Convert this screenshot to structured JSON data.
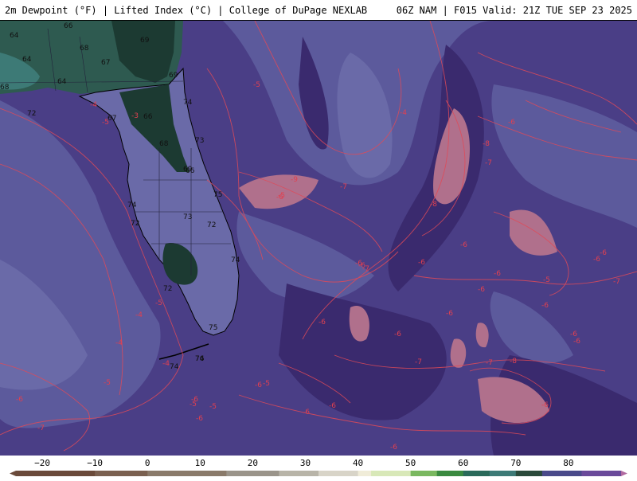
{
  "header": {
    "left_text": "2m Dewpoint (°F) | Lifted Index (°C) | College of DuPage NEXLAB",
    "right_text": "06Z NAM | F015 Valid: 21Z TUE SEP 23 2025"
  },
  "map": {
    "colors": {
      "ocean_deep": "#3a2a6e",
      "ocean_mid": "#4a3e86",
      "ocean_light": "#5c5a9c",
      "land_dew": "#6a6aa8",
      "green_dark": "#1c3a32",
      "green_mid": "#2e5a50",
      "teal": "#3d7a76",
      "pink": "#b0708c",
      "contour": "#e04a58"
    },
    "lifted_index_labels": [
      "-4",
      "-5",
      "-3",
      "-4",
      "-5",
      "-6",
      "-6",
      "-5",
      "-4",
      "-5",
      "-6",
      "-5",
      "-9",
      "-7",
      "-5",
      "-8",
      "-6",
      "-6",
      "-8",
      "-6",
      "-7",
      "-6",
      "-6",
      "-5",
      "-6",
      "-6",
      "-7",
      "-6",
      "-6",
      "-7",
      "-4",
      "-4",
      "-5",
      "-6",
      "-6",
      "-7",
      "-6",
      "-6",
      "-8",
      "-6",
      "-7",
      "-6",
      "-6",
      "-5",
      "-6",
      "-6",
      "-7",
      "-6",
      "-6",
      "-6"
    ],
    "dewpoint_labels": [
      "66",
      "64",
      "64",
      "68",
      "69",
      "67",
      "64",
      "68",
      "69",
      "74",
      "72",
      "67",
      "66",
      "68",
      "73",
      "69",
      "75",
      "72",
      "73",
      "74",
      "74",
      "72",
      "75",
      "72",
      "74",
      "74",
      "76",
      "66"
    ]
  },
  "colorbar": {
    "ticks": [
      "−20",
      "−10",
      "0",
      "10",
      "20",
      "30",
      "40",
      "50",
      "60",
      "70",
      "80"
    ],
    "tick_values": [
      -20,
      -10,
      0,
      10,
      20,
      30,
      40,
      50,
      60,
      70,
      80
    ],
    "range": [
      -25,
      90
    ]
  }
}
